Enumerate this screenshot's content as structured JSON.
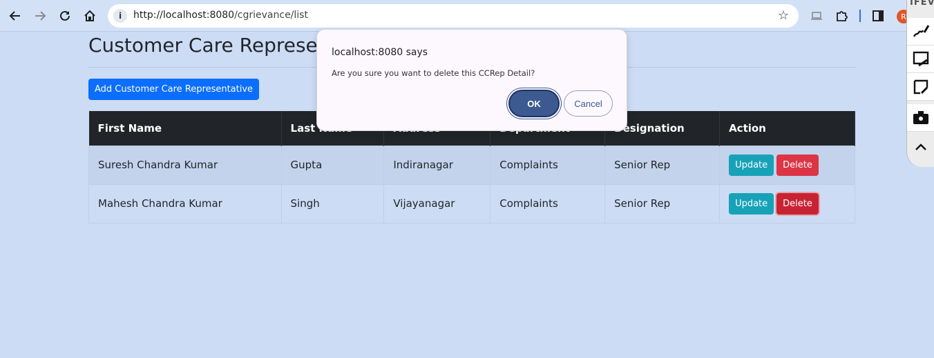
{
  "browser": {
    "url_host": "http://localhost:8080",
    "url_path": "/cgrievance/list",
    "avatar_letter": "R"
  },
  "side_panel": {
    "header": "IFEVU"
  },
  "page": {
    "title": "Customer Care Representa",
    "add_button": "Add Customer Care Representative"
  },
  "table": {
    "headers": [
      "First Name",
      "Last Name",
      "Address",
      "Department",
      "Designation",
      "Action"
    ],
    "rows": [
      {
        "first": "Suresh Chandra Kumar",
        "last": "Gupta",
        "address": "Indiranagar",
        "department": "Complaints",
        "designation": "Senior Rep"
      },
      {
        "first": "Mahesh Chandra Kumar",
        "last": "Singh",
        "address": "Vijayanagar",
        "department": "Complaints",
        "designation": "Senior Rep"
      }
    ],
    "update_label": "Update",
    "delete_label": "Delete"
  },
  "dialog": {
    "title": "localhost:8080 says",
    "message": "Are you sure you want to delete this CCRep Detail?",
    "ok_label": "OK",
    "cancel_label": "Cancel"
  }
}
